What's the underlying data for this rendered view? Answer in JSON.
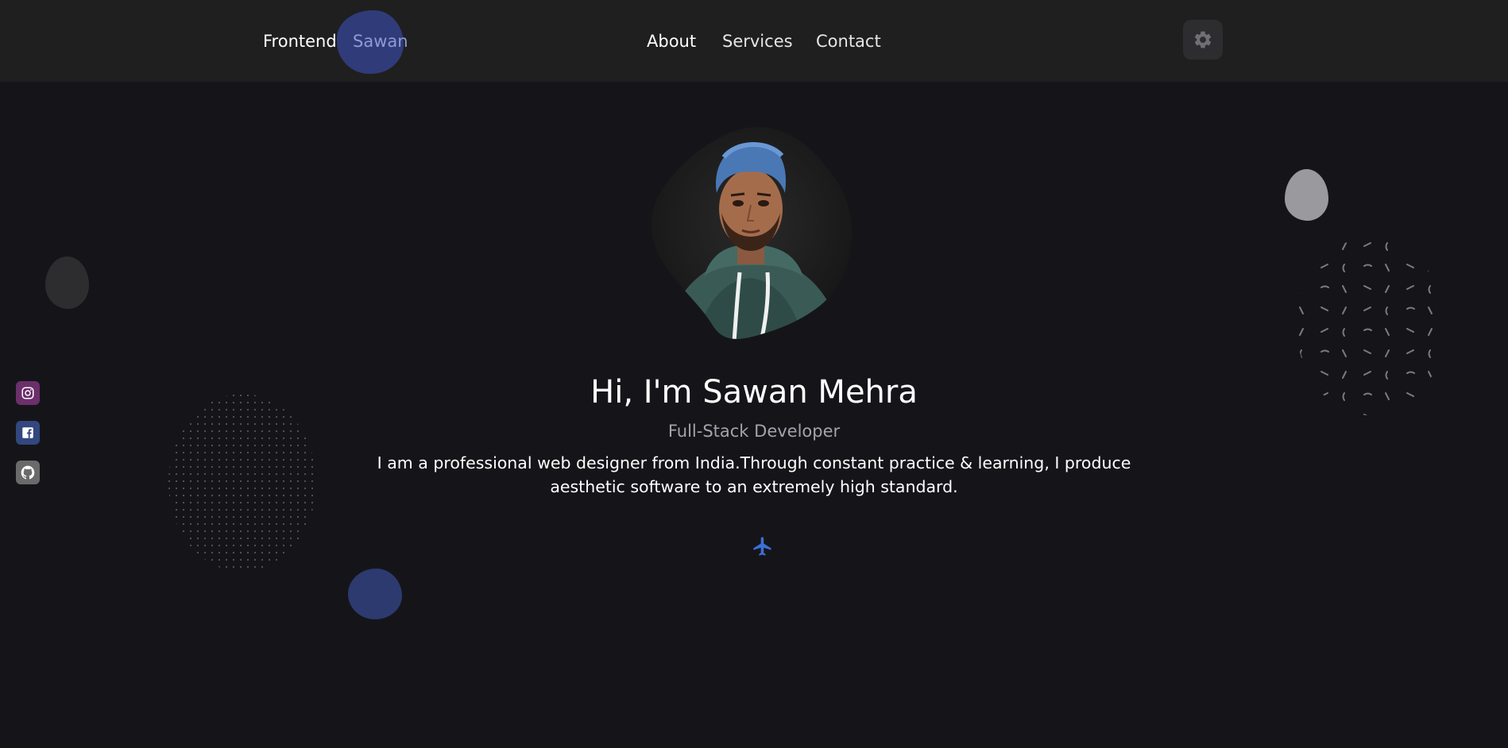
{
  "header": {
    "logo_first": "Frontend",
    "logo_second": "Sawan",
    "nav": [
      {
        "label": "About"
      },
      {
        "label": "Services"
      },
      {
        "label": "Contact"
      }
    ],
    "settings_icon": "gear-icon"
  },
  "social": [
    {
      "name": "instagram",
      "icon": "instagram-icon",
      "color": "#6b2f6b"
    },
    {
      "name": "facebook",
      "icon": "facebook-icon",
      "color": "#33477f"
    },
    {
      "name": "github",
      "icon": "github-icon",
      "color": "#6a6a6a"
    }
  ],
  "hero": {
    "title": "Hi, I'm Sawan Mehra",
    "subtitle": "Full-Stack Developer",
    "description": "I am a professional web designer from India.Through constant practice & learning, I produce aesthetic software to an extremely high standard.",
    "action_icon": "airplane-icon"
  },
  "colors": {
    "background": "#151519",
    "header": "#1f1f1f",
    "accent": "#3c6fd6",
    "logo_blob": "#34418a"
  }
}
